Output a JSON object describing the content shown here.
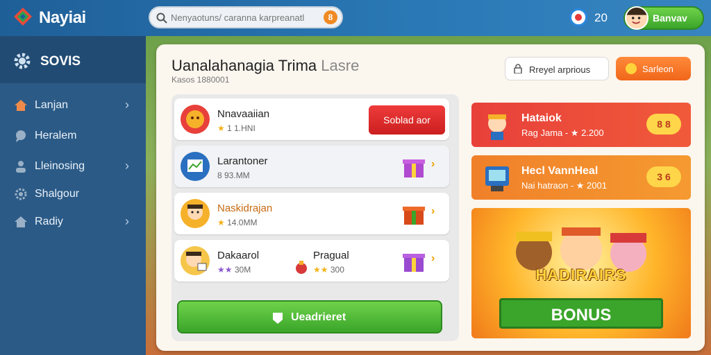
{
  "app": {
    "brand": "Nayiai"
  },
  "search": {
    "placeholder": "Nenyaotuns/ caranna karpreanatl",
    "badge": "8"
  },
  "header": {
    "notif_count": "20",
    "user_label": "Banvav"
  },
  "sidebar": {
    "title": "SOVIS",
    "items": [
      {
        "label": "Lanjan",
        "icon": "home-icon",
        "has_chevron": true
      },
      {
        "label": "Heralem",
        "icon": "chat-icon",
        "has_chevron": false
      },
      {
        "label": "Lleinosing",
        "icon": "user-icon",
        "has_chevron": true
      },
      {
        "label": "Shalgour",
        "icon": "gear-icon",
        "has_chevron": false
      },
      {
        "label": "Radiy",
        "icon": "home-icon",
        "has_chevron": true
      }
    ]
  },
  "main": {
    "title": "Uanalahanagia Trima",
    "title_muted": "Lasre",
    "subtitle": "Kasos 1880001",
    "btn_secondary": "Rreyel arprious",
    "btn_primary": "Sarleon"
  },
  "list": [
    {
      "title": "Nnavaaiian",
      "sub": "1 1.HNI",
      "stars": "★",
      "action": "Soblad aor"
    },
    {
      "title": "Larantoner",
      "sub": "8 93.MM",
      "stars": ""
    },
    {
      "title": "Naskidrajan",
      "sub": "14.0MM",
      "stars": "★"
    },
    {
      "title": "Dakaarol",
      "sub": "30M",
      "stars": "★★",
      "title2": "Pragual",
      "sub2": "300",
      "stars2": "★★"
    }
  ],
  "download_label": "Ueadrieret",
  "cards": [
    {
      "title": "Hataiok",
      "sub": "Rag Jama - ★ 2.200",
      "badge": "8 8",
      "color": "#e8403a"
    },
    {
      "title": "Hecl VannHeal",
      "sub": "Nai hatraon - ★ 2001",
      "badge": "3 6",
      "color": "#f0802a"
    }
  ],
  "banner": {
    "title": "HADIRAIRS",
    "ribbon": "BONUS"
  }
}
